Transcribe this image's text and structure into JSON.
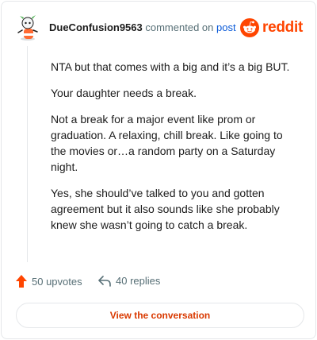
{
  "comment": {
    "username": "DueConfusion9563",
    "action_text": "commented on",
    "link_text": "post",
    "paragraphs": [
      "NTA but that comes with a big and it’s a big BUT.",
      "Your daughter needs a break.",
      "Not a break for a major event like prom or graduation. A relaxing, chill break. Like going to the movies or…a random party on a Saturday night.",
      "Yes, she should’ve talked to you and gotten agreement but it also sounds like she probably knew she wasn’t going to catch a break."
    ]
  },
  "brand": {
    "wordmark": "reddit",
    "color": "#ff4500"
  },
  "stats": {
    "upvotes": "50 upvotes",
    "replies": "40 replies",
    "upvote_color": "#ff4500"
  },
  "cta": {
    "label": "View the conversation",
    "color": "#d93900"
  },
  "icons": {
    "avatar": "snoo-avatar-icon",
    "logo": "reddit-logo-icon",
    "upvote": "upvote-arrow-icon",
    "reply": "reply-arrow-icon"
  }
}
